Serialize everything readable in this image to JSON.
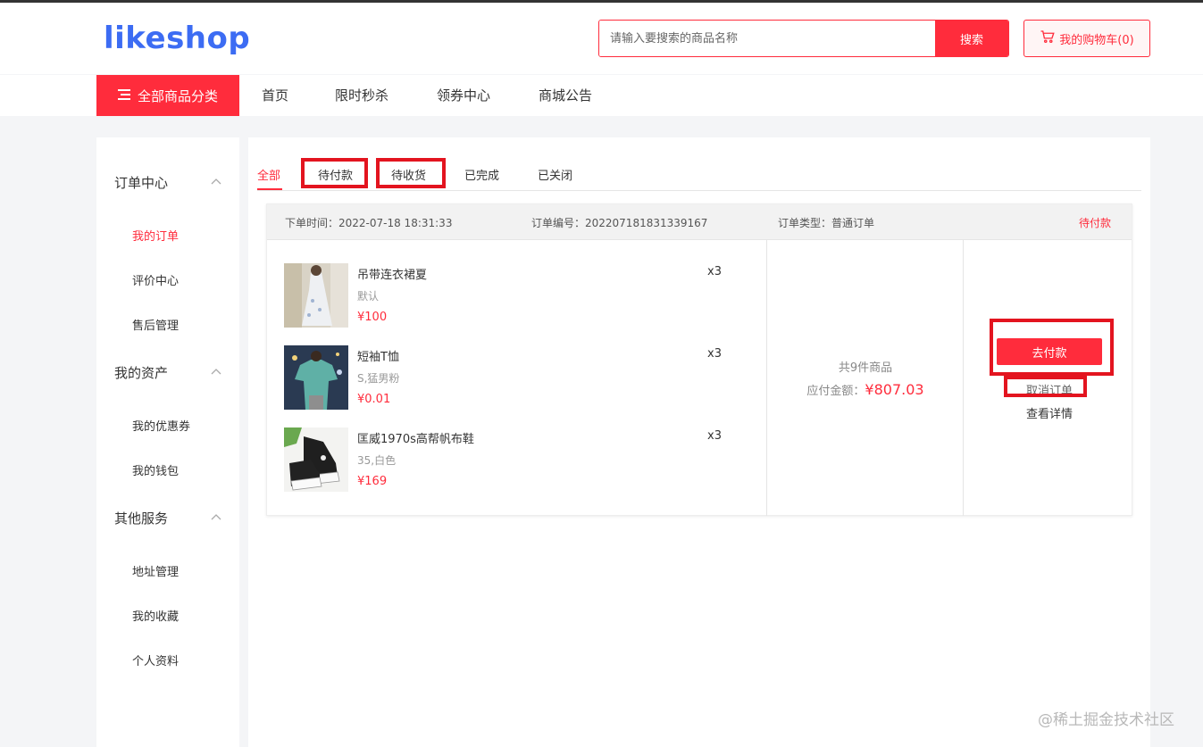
{
  "header": {
    "logo": "likeshop",
    "search_placeholder": "请输入要搜索的商品名称",
    "search_button": "搜索",
    "cart_label": "我的购物车(0)"
  },
  "nav": {
    "category_label": "全部商品分类",
    "items": [
      "首页",
      "限时秒杀",
      "领券中心",
      "商城公告"
    ]
  },
  "sidebar": {
    "groups": [
      {
        "title": "订单中心",
        "links": [
          "我的订单",
          "评价中心",
          "售后管理"
        ]
      },
      {
        "title": "我的资产",
        "links": [
          "我的优惠券",
          "我的钱包"
        ]
      },
      {
        "title": "其他服务",
        "links": [
          "地址管理",
          "我的收藏",
          "个人资料"
        ]
      }
    ],
    "active_link": "我的订单"
  },
  "tabs": [
    "全部",
    "待付款",
    "待收货",
    "已完成",
    "已关闭"
  ],
  "active_tab": "全部",
  "order": {
    "time_label": "下单时间：2022-07-18 18:31:33",
    "number_label": "订单编号：202207181831339167",
    "type_label": "订单类型：普通订单",
    "status": "待付款",
    "products": [
      {
        "name": "吊带连衣裙夏",
        "spec": "默认",
        "price": "¥100",
        "qty": "x3"
      },
      {
        "name": "短袖T恤",
        "spec": "S,猛男粉",
        "price": "¥0.01",
        "qty": "x3"
      },
      {
        "name": "匡威1970s高帮帆布鞋",
        "spec": "35,白色",
        "price": "¥169",
        "qty": "x3"
      }
    ],
    "count_text": "共9件商品",
    "amount_label": "应付金额：",
    "amount_value": "¥807.03",
    "pay_button": "去付款",
    "cancel_link": "取消订单",
    "detail_link": "查看详情"
  },
  "watermark": "@稀土掘金技术社区",
  "colors": {
    "accent": "#ff2c3c",
    "logo": "#3c6cf3",
    "highlight_box": "#e3141f"
  }
}
